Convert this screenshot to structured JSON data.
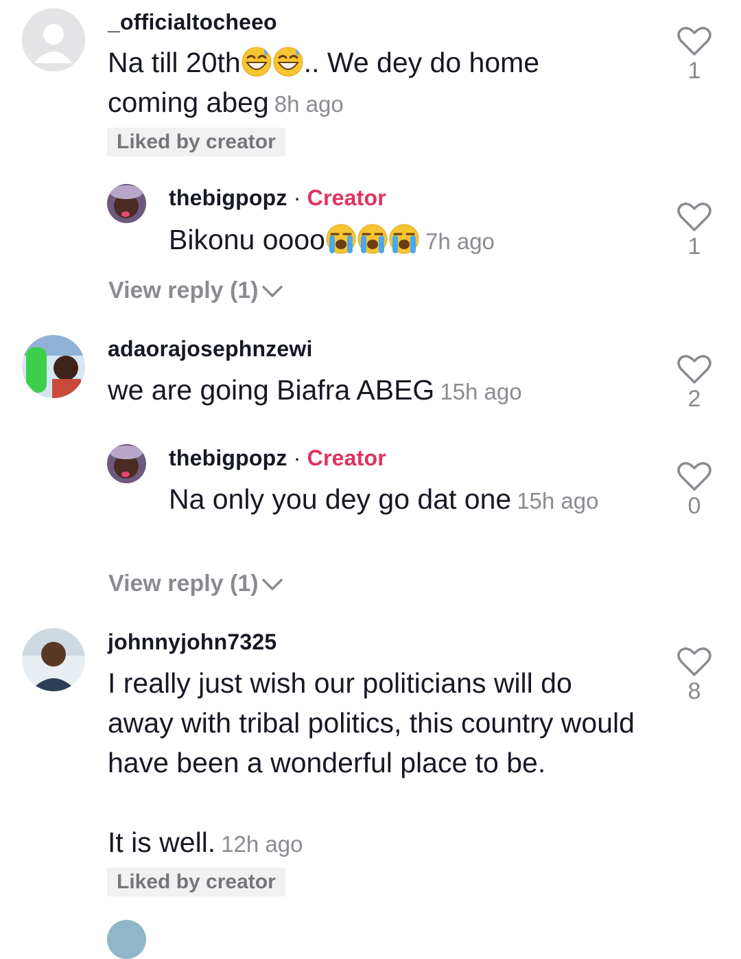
{
  "comments": [
    {
      "username": "_officialtocheeo",
      "text_before": "Na till 20th",
      "emojis": [
        "grinning-sweat-emoji",
        "grinning-sweat-emoji"
      ],
      "text_after": ".. We dey do home coming abeg",
      "time": "8h ago",
      "liked_by_creator": "Liked by creator",
      "likes": "1",
      "reply": {
        "username": "thebigpopz",
        "separator": "·",
        "creator_label": "Creator",
        "text": "Bikonu oooo",
        "emojis": [
          "loudly-crying-emoji",
          "loudly-crying-emoji",
          "loudly-crying-emoji"
        ],
        "time": "7h ago",
        "likes": "1"
      },
      "view_reply": "View reply (1)"
    },
    {
      "username": "adaorajosephnzewi",
      "text": "we are going Biafra ABEG",
      "time": "15h ago",
      "likes": "2",
      "reply": {
        "username": "thebigpopz",
        "separator": "·",
        "creator_label": "Creator",
        "text": "Na only you dey go dat one",
        "time": "15h ago",
        "likes": "0"
      },
      "view_reply": "View reply (1)"
    },
    {
      "username": "johnnyjohn7325",
      "text_line1": "I really just wish our politicians will do away with tribal politics, this country would have been a wonderful place to be.",
      "text_line2": "It is well.",
      "time": "12h ago",
      "liked_by_creator": "Liked by creator",
      "likes": "8"
    }
  ],
  "colors": {
    "text": "#161823",
    "muted": "#8a8b91",
    "creator": "#e0325d",
    "badge_bg": "#f1f1f2"
  }
}
